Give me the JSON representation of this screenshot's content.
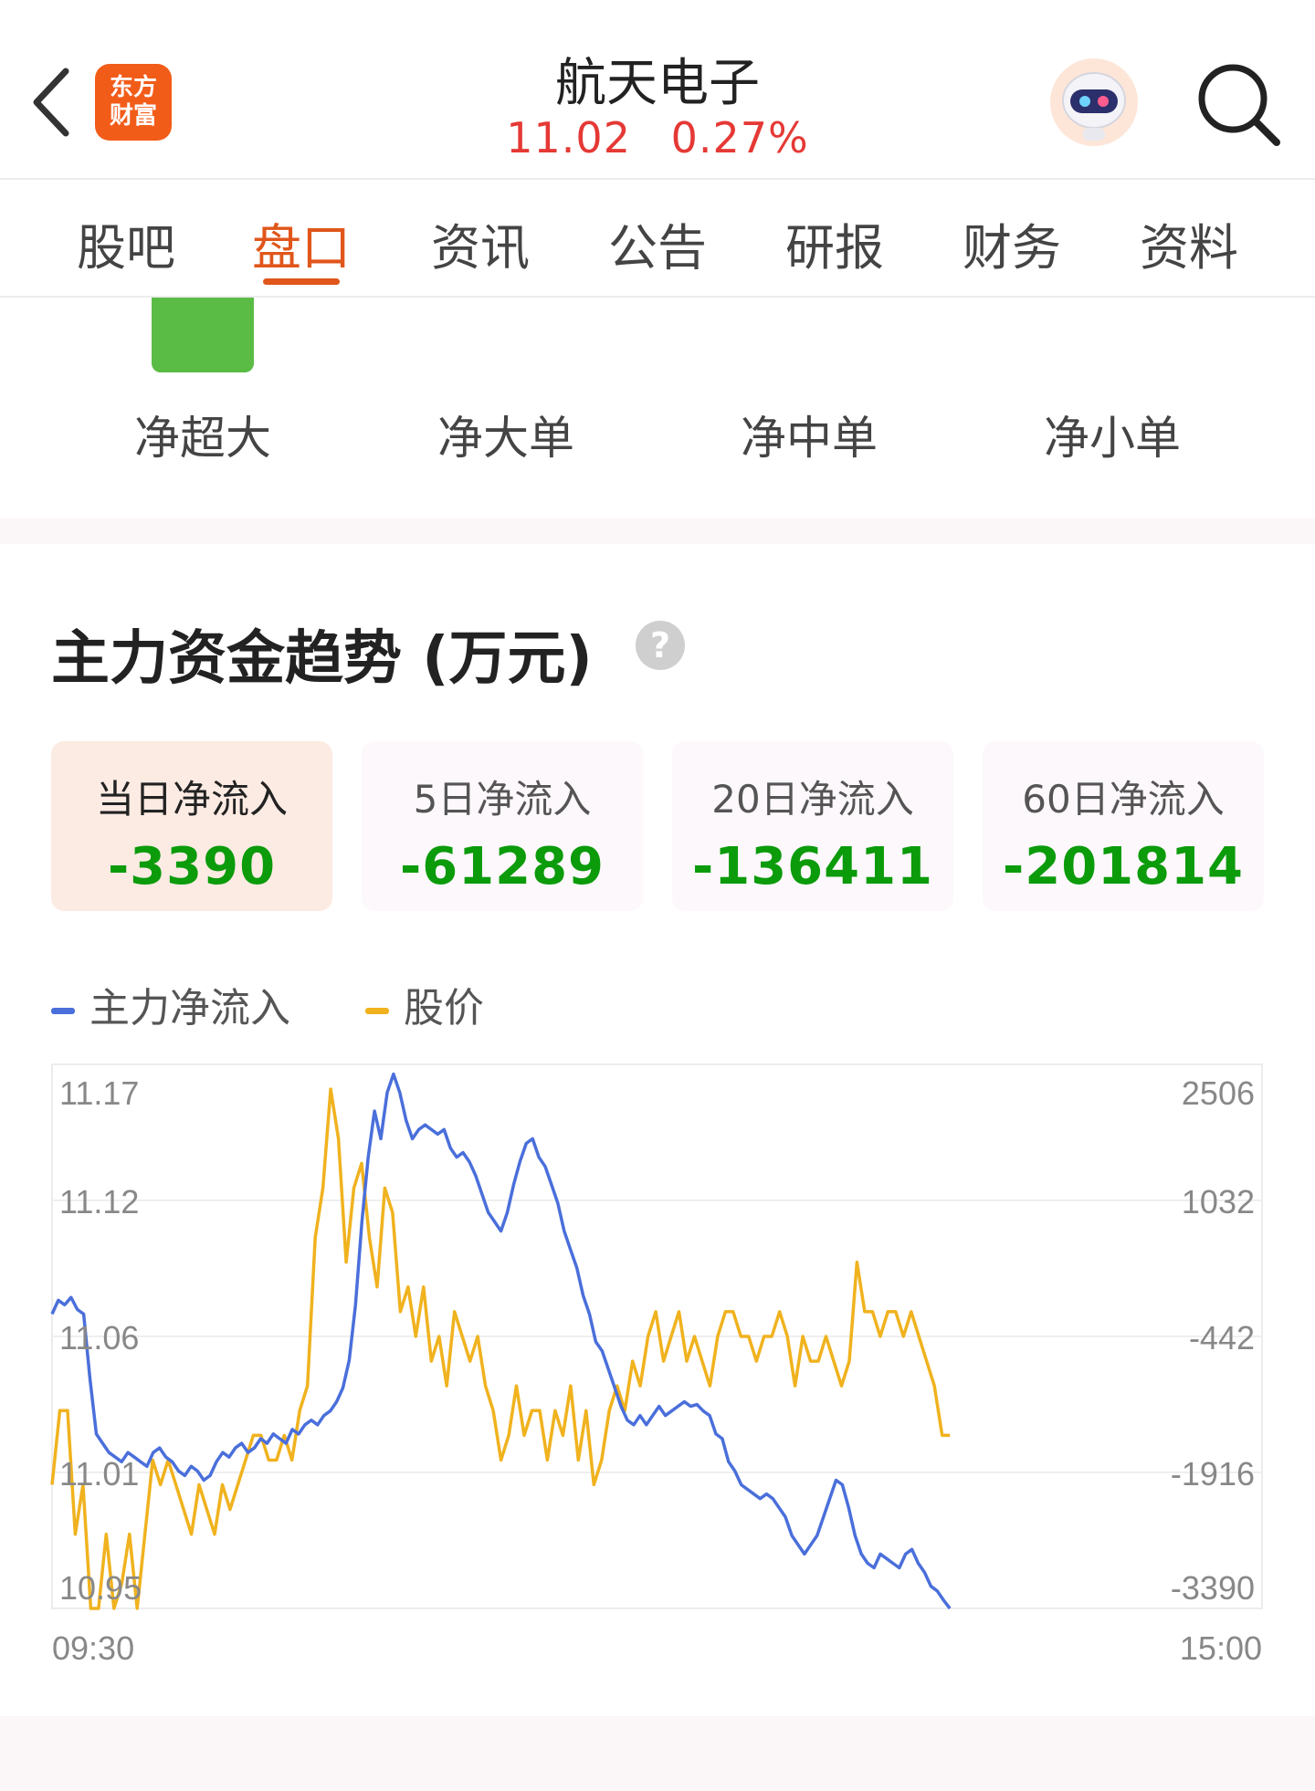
{
  "header": {
    "logo_line1": "东方",
    "logo_line2": "财富",
    "stock_name": "航天电子",
    "price": "11.02",
    "change_pct": "0.27%"
  },
  "tabs": [
    {
      "label": "股吧"
    },
    {
      "label": "盘口"
    },
    {
      "label": "资讯"
    },
    {
      "label": "公告"
    },
    {
      "label": "研报"
    },
    {
      "label": "财务"
    },
    {
      "label": "资料"
    }
  ],
  "active_tab": "盘口",
  "flow_categories": [
    "净超大",
    "净大单",
    "净中单",
    "净小单"
  ],
  "section": {
    "title": "主力资金趋势 (万元)",
    "help_glyph": "?"
  },
  "cards": [
    {
      "label": "当日净流入",
      "value": "-3390"
    },
    {
      "label": "5日净流入",
      "value": "-61289"
    },
    {
      "label": "20日净流入",
      "value": "-136411"
    },
    {
      "label": "60日净流入",
      "value": "-201814"
    }
  ],
  "legend": [
    {
      "name": "主力净流入",
      "color": "#4a6fdb"
    },
    {
      "name": "股价",
      "color": "#f0b21e"
    }
  ],
  "chart_data": {
    "type": "line",
    "x_start": "09:30",
    "x_end": "15:00",
    "left_ticks": [
      "11.17",
      "11.12",
      "11.06",
      "11.01",
      "10.95"
    ],
    "right_ticks": [
      "2506",
      "1032",
      "-442",
      "-1916",
      "-3390"
    ],
    "ylim_price": [
      10.95,
      11.17
    ],
    "ylim_flow": [
      -3390,
      2506
    ],
    "series": [
      {
        "name": "主力净流入",
        "color": "#4a6fdb",
        "values": [
          -200,
          -50,
          -100,
          -20,
          -150,
          -200,
          -900,
          -1500,
          -1600,
          -1700,
          -1750,
          -1800,
          -1700,
          -1750,
          -1800,
          -1850,
          -1700,
          -1650,
          -1750,
          -1800,
          -1900,
          -1950,
          -1850,
          -1900,
          -2000,
          -1950,
          -1800,
          -1700,
          -1750,
          -1650,
          -1600,
          -1700,
          -1650,
          -1550,
          -1600,
          -1500,
          -1550,
          -1600,
          -1450,
          -1500,
          -1400,
          -1350,
          -1400,
          -1300,
          -1250,
          -1150,
          -1000,
          -700,
          -100,
          800,
          1500,
          2000,
          1700,
          2200,
          2400,
          2200,
          1900,
          1700,
          1800,
          1850,
          1800,
          1750,
          1800,
          1600,
          1500,
          1550,
          1450,
          1300,
          1100,
          900,
          800,
          700,
          900,
          1200,
          1450,
          1650,
          1700,
          1500,
          1400,
          1200,
          1000,
          700,
          500,
          300,
          0,
          -200,
          -500,
          -600,
          -800,
          -1000,
          -1200,
          -1350,
          -1400,
          -1300,
          -1400,
          -1300,
          -1200,
          -1300,
          -1250,
          -1200,
          -1150,
          -1200,
          -1180,
          -1250,
          -1300,
          -1500,
          -1550,
          -1800,
          -1900,
          -2050,
          -2100,
          -2150,
          -2200,
          -2150,
          -2200,
          -2300,
          -2400,
          -2600,
          -2700,
          -2800,
          -2700,
          -2600,
          -2400,
          -2200,
          -2000,
          -2050,
          -2300,
          -2600,
          -2800,
          -2900,
          -2950,
          -2800,
          -2850,
          -2900,
          -2950,
          -2800,
          -2750,
          -2900,
          -3000,
          -3150,
          -3200,
          -3300,
          -3390
        ]
      },
      {
        "name": "股价",
        "color": "#f0b21e",
        "values": [
          11.0,
          11.03,
          11.03,
          10.98,
          11.0,
          10.95,
          10.95,
          10.98,
          10.95,
          10.96,
          10.98,
          10.95,
          10.98,
          11.01,
          11.0,
          11.01,
          11.0,
          10.99,
          10.98,
          11.0,
          10.99,
          10.98,
          11.0,
          10.99,
          11.0,
          11.01,
          11.02,
          11.02,
          11.01,
          11.01,
          11.02,
          11.01,
          11.03,
          11.04,
          11.1,
          11.12,
          11.16,
          11.14,
          11.09,
          11.12,
          11.13,
          11.1,
          11.08,
          11.12,
          11.11,
          11.07,
          11.08,
          11.06,
          11.08,
          11.05,
          11.06,
          11.04,
          11.07,
          11.06,
          11.05,
          11.06,
          11.04,
          11.03,
          11.01,
          11.02,
          11.04,
          11.02,
          11.03,
          11.03,
          11.01,
          11.03,
          11.02,
          11.04,
          11.01,
          11.03,
          11.0,
          11.01,
          11.03,
          11.04,
          11.03,
          11.05,
          11.04,
          11.06,
          11.07,
          11.05,
          11.06,
          11.07,
          11.05,
          11.06,
          11.05,
          11.04,
          11.06,
          11.07,
          11.07,
          11.06,
          11.06,
          11.05,
          11.06,
          11.06,
          11.07,
          11.06,
          11.04,
          11.06,
          11.05,
          11.05,
          11.06,
          11.05,
          11.04,
          11.05,
          11.09,
          11.07,
          11.07,
          11.06,
          11.07,
          11.07,
          11.06,
          11.07,
          11.06,
          11.05,
          11.04,
          11.02,
          11.02
        ]
      }
    ]
  }
}
